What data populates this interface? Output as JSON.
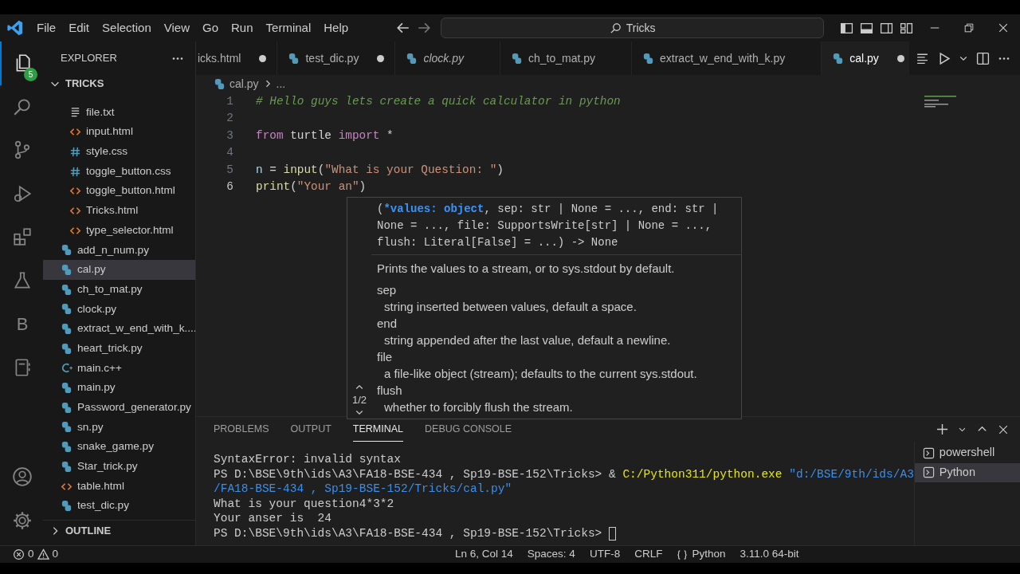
{
  "title_bar": {
    "menus": [
      "File",
      "Edit",
      "Selection",
      "View",
      "Go",
      "Run",
      "Terminal",
      "Help"
    ],
    "search": "Tricks"
  },
  "activity_bar": {
    "items": [
      {
        "kind": "explorer",
        "selected": true,
        "badge": "5"
      },
      {
        "kind": "search",
        "selected": false
      },
      {
        "kind": "source-control",
        "selected": false
      },
      {
        "kind": "run-debug",
        "selected": false
      },
      {
        "kind": "extensions",
        "selected": false
      },
      {
        "kind": "testing",
        "selected": false
      },
      {
        "kind": "letter",
        "text": "B",
        "selected": false
      },
      {
        "kind": "notebook",
        "selected": false
      }
    ],
    "bottom": [
      {
        "kind": "account"
      },
      {
        "kind": "settings"
      }
    ]
  },
  "explorer": {
    "title": "EXPLORER",
    "folder": "TRICKS",
    "folder_expanded": true,
    "subfolder_files": [
      {
        "label": "file.txt",
        "kind": "txt",
        "selected": false
      },
      {
        "label": "input.html",
        "kind": "html",
        "selected": false
      },
      {
        "label": "style.css",
        "kind": "css",
        "selected": false
      },
      {
        "label": "toggle_button.css",
        "kind": "css",
        "selected": false
      },
      {
        "label": "toggle_button.html",
        "kind": "html",
        "selected": false
      },
      {
        "label": "Tricks.html",
        "kind": "html",
        "selected": false
      },
      {
        "label": "type_selector.html",
        "kind": "html",
        "selected": false
      }
    ],
    "files": [
      {
        "label": "add_n_num.py",
        "kind": "python",
        "selected": false
      },
      {
        "label": "cal.py",
        "kind": "python",
        "selected": true
      },
      {
        "label": "ch_to_mat.py",
        "kind": "python",
        "selected": false
      },
      {
        "label": "clock.py",
        "kind": "python",
        "selected": false
      },
      {
        "label": "extract_w_end_with_k....",
        "kind": "python",
        "selected": false
      },
      {
        "label": "heart_trick.py",
        "kind": "python",
        "selected": false
      },
      {
        "label": "main.c++",
        "kind": "cpp",
        "selected": false
      },
      {
        "label": "main.py",
        "kind": "python",
        "selected": false
      },
      {
        "label": "Password_generator.py",
        "kind": "python",
        "selected": false
      },
      {
        "label": "sn.py",
        "kind": "python",
        "selected": false
      },
      {
        "label": "snake_game.py",
        "kind": "python",
        "selected": false
      },
      {
        "label": "Star_trick.py",
        "kind": "python",
        "selected": false
      },
      {
        "label": "table.html",
        "kind": "html",
        "selected": false
      },
      {
        "label": "test_dic.py",
        "kind": "python",
        "selected": false
      }
    ],
    "outline": {
      "label": "OUTLINE",
      "expanded": false
    }
  },
  "tabs": [
    {
      "label": "icks.html",
      "modified": true,
      "preview": false,
      "selected": false
    },
    {
      "label": "test_dic.py",
      "kind": "python",
      "modified": true,
      "preview": false,
      "selected": false
    },
    {
      "label": "clock.py",
      "kind": "python",
      "modified": false,
      "preview": true,
      "selected": false
    },
    {
      "label": "ch_to_mat.py",
      "kind": "python",
      "modified": false,
      "preview": false,
      "selected": false
    },
    {
      "label": "extract_w_end_with_k.py",
      "kind": "python",
      "modified": false,
      "preview": false,
      "selected": false
    },
    {
      "label": "cal.py",
      "kind": "python",
      "modified": true,
      "preview": false,
      "selected": true
    }
  ],
  "breadcrumb": [
    "cal.py",
    "..."
  ],
  "code": [
    {
      "number": "1",
      "tokens": [
        {
          "text": "# Hello guys lets create a quick calculator in python",
          "kind": "comment"
        }
      ]
    },
    {
      "number": "2"
    },
    {
      "number": "3",
      "tokens": [
        {
          "text": "from",
          "kind": "keyword"
        },
        {
          "text": " turtle ",
          "kind": "plain"
        },
        {
          "text": "import",
          "kind": "keyword"
        },
        {
          "text": " *",
          "kind": "plain"
        }
      ]
    },
    {
      "number": "4"
    },
    {
      "number": "5",
      "tokens": [
        {
          "text": "n",
          "kind": "variable"
        },
        {
          "text": " = ",
          "kind": "plain"
        },
        {
          "text": "input",
          "kind": "function"
        },
        {
          "text": "(",
          "kind": "plain"
        },
        {
          "text": "\"What is your Question: \"",
          "kind": "string"
        },
        {
          "text": ")",
          "kind": "plain"
        }
      ]
    },
    {
      "number": "6",
      "tokens": [
        {
          "text": "print",
          "kind": "function"
        },
        {
          "text": "(",
          "kind": "plain"
        },
        {
          "text": "\"Your an\"",
          "kind": "string"
        },
        {
          "text": ")",
          "kind": "plain"
        }
      ]
    }
  ],
  "hover": {
    "signature": [
      {
        "text": "(",
        "highlighted": false
      },
      {
        "text": "*values: object",
        "highlighted": true
      },
      {
        "text": ", sep: str | None = ..., end: str | None = ..., file: SupportsWrite[str] | None = ..., flush: Literal[False] = ...) -> None",
        "highlighted": false
      }
    ],
    "description": "Prints the values to a stream, or to sys.stdout by default.",
    "params": [
      {
        "name": "sep",
        "doc": "string inserted between values, default a space."
      },
      {
        "name": "end",
        "doc": "string appended after the last value, default a newline."
      },
      {
        "name": "file",
        "doc": "a file-like object (stream); defaults to the current sys.stdout."
      },
      {
        "name": "flush",
        "doc": "whether to forcibly flush the stream."
      }
    ],
    "counter": "1/2"
  },
  "panel": {
    "tabs": [
      {
        "label": "PROBLEMS",
        "selected": false
      },
      {
        "label": "OUTPUT",
        "selected": false
      },
      {
        "label": "TERMINAL",
        "selected": true
      },
      {
        "label": "DEBUG CONSOLE",
        "selected": false
      }
    ],
    "terminal_lines": [
      {
        "tokens": [
          {
            "text": "SyntaxError: invalid syntax",
            "kind": "plain"
          }
        ],
        "cursor": false
      },
      {
        "tokens": [
          {
            "text": "PS D:\\BSE\\9th\\ids\\A3\\FA18-BSE-434 , Sp19-BSE-152\\Tricks> & ",
            "kind": "plain"
          },
          {
            "text": "C:/Python311/python.exe",
            "kind": "command"
          },
          {
            "text": " \"d:/BSE/9th/ids/A3",
            "kind": "string"
          }
        ],
        "cursor": false
      },
      {
        "tokens": [
          {
            "text": "/FA18-BSE-434 , Sp19-BSE-152/Tricks/cal.py\"",
            "kind": "string"
          }
        ],
        "cursor": false
      },
      {
        "tokens": [
          {
            "text": "What is your question4*3*2",
            "kind": "plain"
          }
        ],
        "cursor": false
      },
      {
        "tokens": [
          {
            "text": "Your anser is  24",
            "kind": "plain"
          }
        ],
        "cursor": false
      },
      {
        "tokens": [
          {
            "text": "PS D:\\BSE\\9th\\ids\\A3\\FA18-BSE-434 , Sp19-BSE-152\\Tricks> ",
            "kind": "plain"
          }
        ],
        "cursor": true
      }
    ],
    "terminals": [
      {
        "label": "powershell",
        "selected": false
      },
      {
        "label": "Python",
        "selected": true
      }
    ]
  },
  "status_bar": {
    "errors": "0",
    "warnings": "0",
    "items": [
      {
        "text": "Ln 6, Col 14",
        "kind": "position"
      },
      {
        "text": "Spaces: 4",
        "kind": "indentation"
      },
      {
        "text": "UTF-8",
        "kind": "encoding"
      },
      {
        "text": "CRLF",
        "kind": "line-ending"
      },
      {
        "text": "Python",
        "kind": "language"
      },
      {
        "text": "3.11.0 64-bit",
        "kind": "interpreter"
      }
    ]
  }
}
